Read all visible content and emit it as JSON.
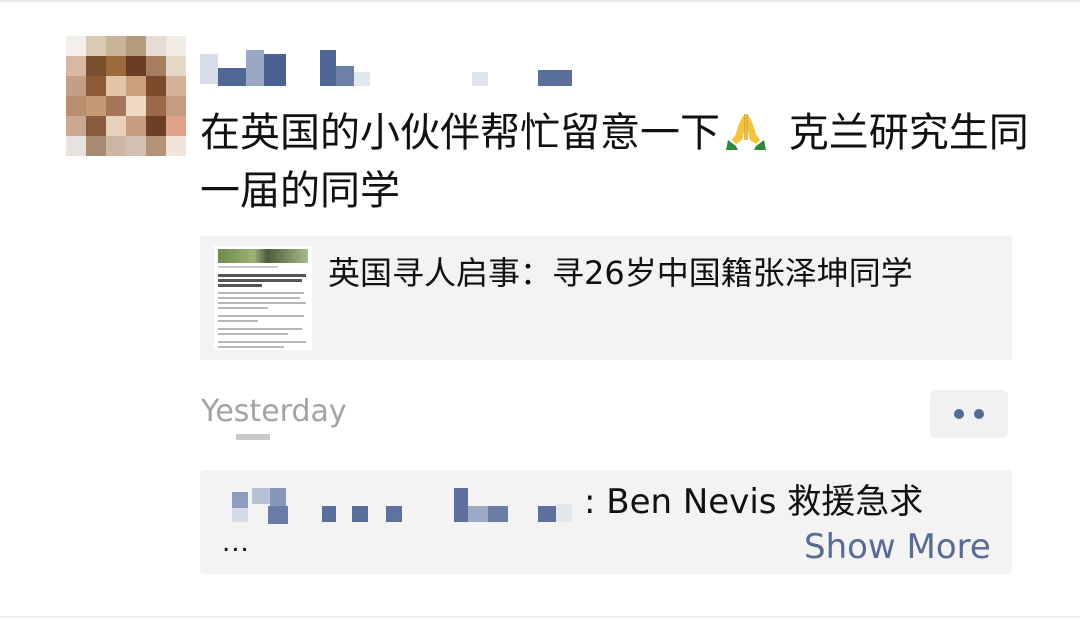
{
  "post": {
    "text": "在英国的小伙伴帮忙留意一下",
    "text_tail": " 克兰研究生同一届的同学",
    "emoji": "folded-hands-emoji"
  },
  "link_card": {
    "title": "英国寻人启事：寻26岁中国籍张泽坤同学"
  },
  "meta": {
    "timestamp": "Yesterday"
  },
  "comment": {
    "text": ": Ben Nevis 救援急求",
    "ellipsis": "...",
    "show_more": "Show More"
  },
  "colors": {
    "link_blue": "#576b95",
    "card_bg": "#f3f3f3",
    "timestamp_gray": "#a3a3a3"
  }
}
